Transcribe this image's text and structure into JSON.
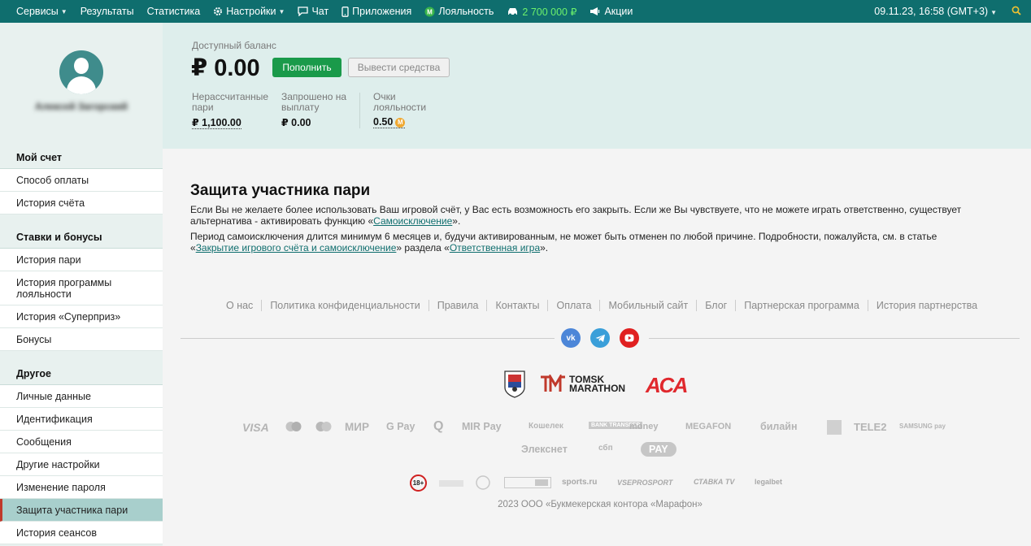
{
  "topbar": {
    "items": [
      {
        "label": "Сервисы",
        "caret": true
      },
      {
        "label": "Результаты"
      },
      {
        "label": "Статистика"
      },
      {
        "label": "Настройки",
        "caret": true
      },
      {
        "label": "Чат"
      },
      {
        "label": "Приложения"
      },
      {
        "label": "Лояльность"
      },
      {
        "label": "2 700 000 ₽"
      },
      {
        "label": "Акции"
      }
    ],
    "datetime": "09.11.23, 16:58 (GMT+3)"
  },
  "sidebar": {
    "profile_name": "Алексей Загорский",
    "groups": [
      {
        "title": "Мой счет",
        "items": [
          "Способ оплаты",
          "История счёта"
        ]
      },
      {
        "title": "Ставки и бонусы",
        "items": [
          "История пари",
          "История программы лояльности",
          "История «Суперприз»",
          "Бонусы"
        ]
      },
      {
        "title": "Другое",
        "items": [
          "Личные данные",
          "Идентификация",
          "Сообщения",
          "Другие настройки",
          "Изменение пароля",
          "Защита участника пари",
          "История сеансов"
        ]
      }
    ],
    "active_item": "Защита участника пари"
  },
  "balance": {
    "label": "Доступный баланс",
    "amount": "₽ 0.00",
    "topup_label": "Пополнить",
    "withdraw_label": "Вывести средства",
    "unsettled_label": "Нерассчитанные пари",
    "unsettled_value": "₽ 1,100.00",
    "requested_label": "Запрошено на выплату",
    "requested_value": "₽ 0.00",
    "loyalty_label": "Очки лояльности",
    "loyalty_value": "0.50"
  },
  "content": {
    "title": "Защита участника пари",
    "p1_a": "Если Вы не желаете более использовать Ваш игровой счёт, у Вас есть возможность его закрыть. Если же Вы чувствуете, что не можете играть ответственно, существует альтернатива - активировать функцию «",
    "p1_link": "Самоисключение",
    "p1_b": "».",
    "p2_a": "Период самоисключения длится минимум 6 месяцев и, будучи активированным, не может быть отменен по любой причине. Подробности, пожалуйста, см. в статье «",
    "p2_link1": "Закрытие игрового счёта и самоисключение",
    "p2_mid": "» раздела «",
    "p2_link2": "Ответственная игра",
    "p2_b": "»."
  },
  "footer": {
    "links": [
      "О нас",
      "Политика конфиденциальности",
      "Правила",
      "Контакты",
      "Оплата",
      "Мобильный сайт",
      "Блог",
      "Партнерская программа",
      "История партнерства"
    ],
    "social": [
      "vk",
      "telegram",
      "youtube"
    ],
    "sponsor_tomsk": "TOMSK MARATHON",
    "sponsor_aca": "АСА",
    "payments": [
      "VISA",
      "МИР",
      "G Pay",
      "MIR Pay",
      "Кошелек",
      "BANK TRANSFER",
      "money",
      "MEGAFON",
      "билайн",
      "TELE2",
      "SAMSUNG pay",
      "Элекснет",
      "сбп",
      "PAY"
    ],
    "badges": [
      "18+",
      "sports.ru",
      "VSEPROSPORT",
      "СТАВКА TV",
      "legalbet"
    ],
    "copyright": "2023 ООО «Букмекерская контора «Марафон»"
  }
}
